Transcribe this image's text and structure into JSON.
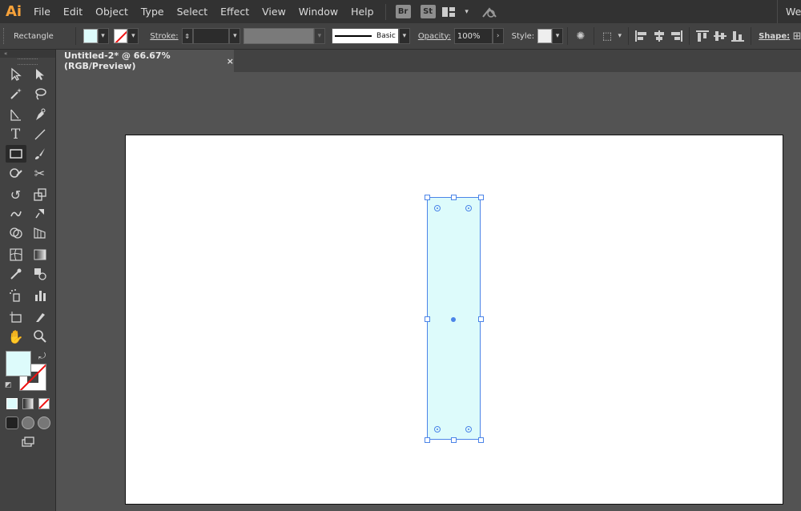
{
  "app": {
    "logo": "Ai",
    "workspace": "Web"
  },
  "menu": [
    "File",
    "Edit",
    "Object",
    "Type",
    "Select",
    "Effect",
    "View",
    "Window",
    "Help"
  ],
  "badges": {
    "bridge": "Br",
    "stock": "St"
  },
  "controlbar": {
    "tool_name": "Rectangle",
    "stroke_label": "Stroke:",
    "brush_label": "Basic",
    "opacity_label": "Opacity:",
    "opacity_value": "100%",
    "style_label": "Style:",
    "shape_label": "Shape:"
  },
  "document": {
    "tab_title": "Untitled-2* @ 66.67% (RGB/Preview)",
    "close": "×"
  },
  "colors": {
    "fill": "#ddfbfb",
    "selection": "#4b84e8",
    "logo": "#f7a23a"
  },
  "tools": [
    [
      "selection-tool",
      "direct-selection-tool"
    ],
    [
      "magic-wand-tool",
      "lasso-tool"
    ],
    [
      "pen-tool",
      "curvature-tool"
    ],
    [
      "type-tool",
      "line-segment-tool"
    ],
    [
      "rectangle-tool",
      "paintbrush-tool"
    ],
    [
      "shaper-tool",
      "scissors-tool"
    ],
    [
      "rotate-tool",
      "scale-tool"
    ],
    [
      "warp-tool",
      "free-transform-tool"
    ],
    [
      "shape-builder-tool",
      "perspective-grid-tool"
    ],
    [
      "mesh-tool",
      "gradient-tool"
    ],
    [
      "eyedropper-tool",
      "blend-tool"
    ],
    [
      "symbol-sprayer-tool",
      "column-graph-tool"
    ],
    [
      "artboard-tool",
      "slice-tool"
    ],
    [
      "hand-tool",
      "zoom-tool"
    ]
  ]
}
